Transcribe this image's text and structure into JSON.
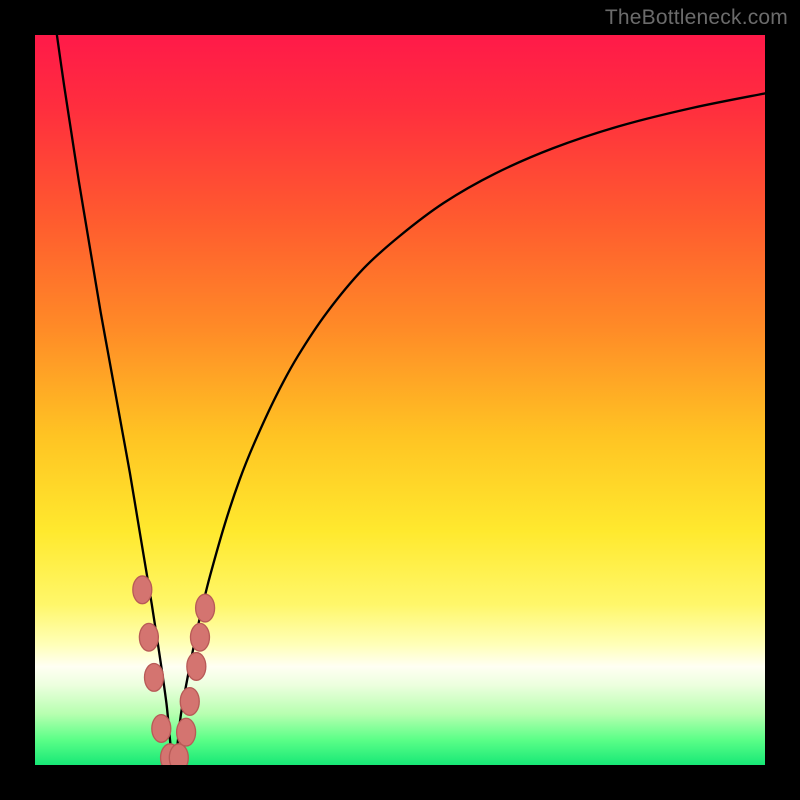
{
  "watermark": "TheBottleneck.com",
  "colors": {
    "gradient_stops": [
      {
        "offset": 0.0,
        "color": "#ff1a49"
      },
      {
        "offset": 0.1,
        "color": "#ff2e3e"
      },
      {
        "offset": 0.25,
        "color": "#ff5a2f"
      },
      {
        "offset": 0.4,
        "color": "#ff8a27"
      },
      {
        "offset": 0.55,
        "color": "#ffc423"
      },
      {
        "offset": 0.68,
        "color": "#ffe92e"
      },
      {
        "offset": 0.78,
        "color": "#fff76a"
      },
      {
        "offset": 0.835,
        "color": "#ffffb8"
      },
      {
        "offset": 0.865,
        "color": "#fffff3"
      },
      {
        "offset": 0.89,
        "color": "#edffdf"
      },
      {
        "offset": 0.93,
        "color": "#b7ffb0"
      },
      {
        "offset": 0.965,
        "color": "#5cff88"
      },
      {
        "offset": 1.0,
        "color": "#17e876"
      }
    ],
    "curve": "#000000",
    "marker_fill": "#d47470",
    "marker_stroke": "#b85a57"
  },
  "chart_data": {
    "type": "line",
    "title": "",
    "xlabel": "",
    "ylabel": "",
    "xlim": [
      0,
      100
    ],
    "ylim": [
      0,
      100
    ],
    "x_minimum": 19,
    "series": [
      {
        "name": "bottleneck-curve",
        "x": [
          3,
          4,
          5,
          6,
          7,
          8,
          9,
          10,
          11,
          12,
          13,
          14,
          15,
          16,
          17,
          18,
          19,
          20,
          21,
          22,
          23,
          24,
          26,
          28,
          30,
          33,
          36,
          40,
          45,
          50,
          56,
          63,
          71,
          80,
          90,
          100
        ],
        "y": [
          100,
          93,
          86.5,
          80,
          74,
          68,
          62,
          56.5,
          51,
          45.5,
          40,
          34,
          28,
          22,
          15.5,
          8.5,
          0,
          7,
          12.5,
          17.5,
          22,
          26,
          33,
          39,
          44,
          50.5,
          56,
          62,
          68,
          72.5,
          77,
          81,
          84.5,
          87.5,
          90,
          92
        ]
      }
    ],
    "markers": [
      {
        "x": 14.7,
        "y": 24.0
      },
      {
        "x": 15.6,
        "y": 17.5
      },
      {
        "x": 16.3,
        "y": 12.0
      },
      {
        "x": 17.3,
        "y": 5.0
      },
      {
        "x": 18.5,
        "y": 1.0
      },
      {
        "x": 19.7,
        "y": 1.0
      },
      {
        "x": 20.7,
        "y": 4.5
      },
      {
        "x": 21.2,
        "y": 8.7
      },
      {
        "x": 22.1,
        "y": 13.5
      },
      {
        "x": 22.6,
        "y": 17.5
      },
      {
        "x": 23.3,
        "y": 21.5
      }
    ],
    "marker_rx": 1.3,
    "marker_ry": 1.9
  }
}
